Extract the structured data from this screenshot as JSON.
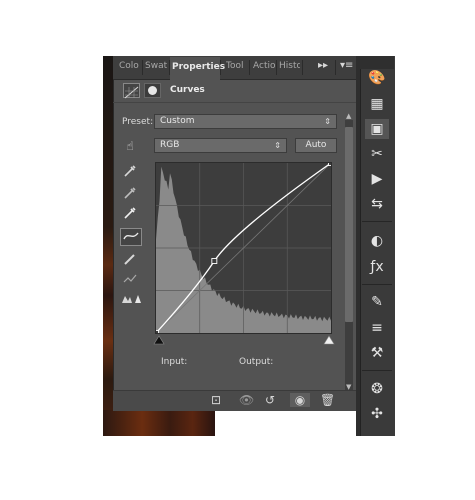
{
  "tabs": [
    {
      "label": "Colo"
    },
    {
      "label": "Swat"
    },
    {
      "label": "Properties"
    },
    {
      "label": "Tool"
    },
    {
      "label": "Actio"
    },
    {
      "label": "Histo"
    }
  ],
  "header": {
    "title": "Curves"
  },
  "preset": {
    "label": "Preset:",
    "value": "Custom"
  },
  "channel": {
    "value": "RGB"
  },
  "auto_button": {
    "label": "Auto"
  },
  "io": {
    "input_label": "Input:",
    "output_label": "Output:"
  },
  "icons": {
    "tab_overflow": "double-chevron-right-icon",
    "panel_menu": "panel-menu-icon",
    "adjustment_layer": "curves-adjustment-icon",
    "mask": "mask-icon"
  },
  "colors": {
    "panel_bg": "#535353",
    "dark_bg": "#3e3e3e",
    "curve": "#ffffff"
  },
  "tools": [
    {
      "name": "on-image-adjust-icon"
    },
    {
      "name": "eyedropper-black-icon"
    },
    {
      "name": "eyedropper-gray-icon"
    },
    {
      "name": "eyedropper-white-icon"
    },
    {
      "name": "curve-points-icon"
    },
    {
      "name": "pencil-icon"
    },
    {
      "name": "smooth-icon"
    },
    {
      "name": "clipping-warning-icon"
    }
  ],
  "curve": {
    "points": [
      [
        0,
        0
      ],
      [
        85,
        108
      ],
      [
        255,
        255
      ]
    ],
    "histogram_shape": "peak-left"
  }
}
